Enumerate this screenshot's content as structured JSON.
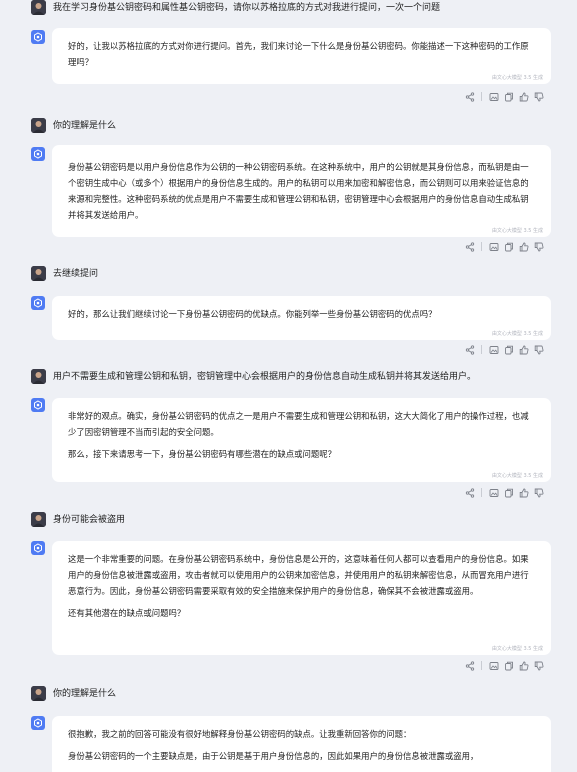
{
  "ai_note": "由文心大模型 3.5 生成",
  "messages": [
    {
      "role": "user",
      "text": "我在学习身份基公钥密码和属性基公钥密码，请你以苏格拉底的方式对我进行提问，一次一个问题"
    },
    {
      "role": "bot",
      "paragraphs": [
        "好的，让我以苏格拉底的方式对你进行提问。首先，我们来讨论一下什么是身份基公钥密码。你能描述一下这种密码的工作原理吗？"
      ]
    },
    {
      "role": "user",
      "text": "你的理解是什么"
    },
    {
      "role": "bot",
      "paragraphs": [
        "身份基公钥密码是以用户身份信息作为公钥的一种公钥密码系统。在这种系统中，用户的公钥就是其身份信息，而私钥是由一个密钥生成中心（或多个）根据用户的身份信息生成的。用户的私钥可以用来加密和解密信息，而公钥则可以用来验证信息的来源和完整性。这种密码系统的优点是用户不需要生成和管理公钥和私钥，密钥管理中心会根据用户的身份信息自动生成私钥并将其发送给用户。"
      ]
    },
    {
      "role": "user",
      "text": "去继续提问"
    },
    {
      "role": "bot",
      "paragraphs": [
        "好的，那么让我们继续讨论一下身份基公钥密码的优缺点。你能列举一些身份基公钥密码的优点吗？"
      ]
    },
    {
      "role": "user",
      "text": "用户不需要生成和管理公钥和私钥，密钥管理中心会根据用户的身份信息自动生成私钥并将其发送给用户。"
    },
    {
      "role": "bot",
      "paragraphs": [
        "非常好的观点。确实，身份基公钥密码的优点之一是用户不需要生成和管理公钥和私钥，这大大简化了用户的操作过程，也减少了因密钥管理不当而引起的安全问题。",
        "那么，接下来请思考一下，身份基公钥密码有哪些潜在的缺点或问题呢？"
      ]
    },
    {
      "role": "user",
      "text": "身份可能会被盗用"
    },
    {
      "role": "bot",
      "paragraphs": [
        "这是一个非常重要的问题。在身份基公钥密码系统中，身份信息是公开的，这意味着任何人都可以查看用户的身份信息。如果用户的身份信息被泄露或盗用，攻击者就可以使用用户的公钥来加密信息，并使用用户的私钥来解密信息，从而冒充用户进行恶意行为。因此，身份基公钥密码需要采取有效的安全措施来保护用户的身份信息，确保其不会被泄露或盗用。",
        "还有其他潜在的缺点或问题吗？"
      ]
    },
    {
      "role": "user",
      "text": "你的理解是什么"
    },
    {
      "role": "bot",
      "paragraphs": [
        "很抱歉，我之前的回答可能没有很好地解释身份基公钥密码的缺点。让我重新回答你的问题：",
        "身份基公钥密码的一个主要缺点是，由于公钥是基于用户身份信息的，因此如果用户的身份信息被泄露或盗用，"
      ]
    }
  ]
}
